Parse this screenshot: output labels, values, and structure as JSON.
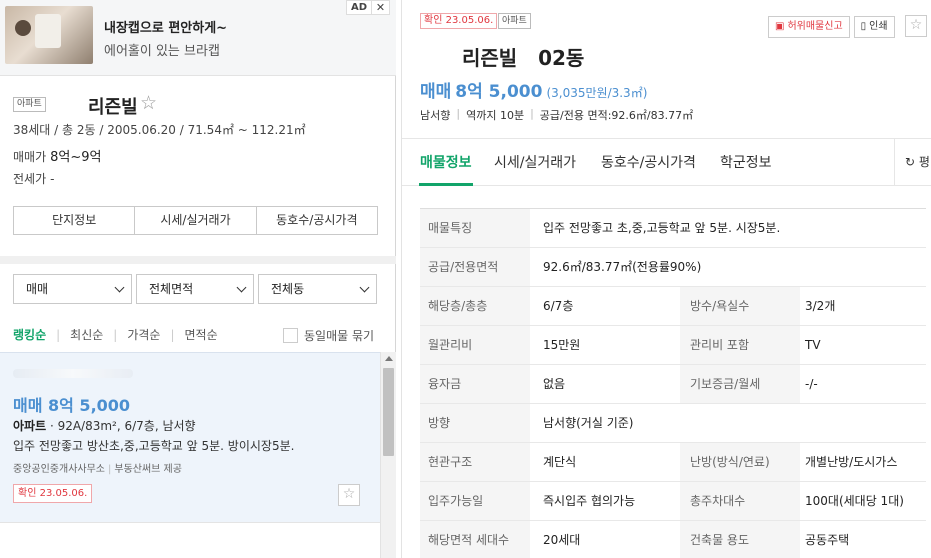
{
  "ad": {
    "title": "내장캡으로 편안하게~",
    "subtitle": "에어홀이 있는 브라캡",
    "badge": "AD",
    "close": "✕"
  },
  "complex": {
    "type_tag": "아파트",
    "name": "리즌빌",
    "star": "☆",
    "info": "38세대 / 총 2동 / 2005.06.20 / 71.54㎡ ~ 112.21㎡",
    "trade_label": "매매가",
    "trade_value": "8억~9억",
    "jeonse_label": "전세가",
    "jeonse_value": "-",
    "buttons": [
      "단지정보",
      "시세/실거래가",
      "동호수/공시가격"
    ]
  },
  "filters": {
    "trade_type": "매매",
    "area": "전체면적",
    "dong": "전체동",
    "sorts": [
      "랭킹순",
      "최신순",
      "가격순",
      "면적순"
    ],
    "group_label": "동일매물 묶기"
  },
  "listing": {
    "price": "매매 8억 5,000",
    "type": "아파트",
    "spec": " · 92A/83m², 6/7층, 남서향",
    "desc": "입주 전망좋고 방산초,중,고등학교 앞 5분. 방이시장5분.",
    "agent": "중앙공인중개사사무소",
    "provider": "부동산써브 제공",
    "confirm": "확인 23.05.06.",
    "fav": "☆"
  },
  "detail": {
    "confirm_tag": "확인 23.05.06.",
    "type_tag": "아파트",
    "report_btn": "허위매물신고",
    "print_btn": "인쇄",
    "fav": "☆",
    "title": "리즌빌   02동",
    "trade": "매매",
    "price": "8억 5,000",
    "unit_price": "(3,035만원/3.3㎡)",
    "summary": [
      "남서향",
      "역까지 10분",
      "공급/전용 면적:92.6㎡/83.77㎡"
    ],
    "tabs": [
      "매물정보",
      "시세/실거래가",
      "동호수/공시가격",
      "학군정보"
    ],
    "refresh": "평",
    "rows": [
      {
        "label": "매물특징",
        "value": "입주 전망좋고      초,중,고등학교 앞 5분.      시장5분."
      },
      {
        "label": "공급/전용면적",
        "value": "92.6㎡/83.77㎡(전용률90%)"
      },
      {
        "label": "해당층/총층",
        "value": "6/7층",
        "label2": "방수/욕실수",
        "value2": "3/2개"
      },
      {
        "label": "월관리비",
        "value": "15만원",
        "label2": "관리비 포함",
        "value2": "TV"
      },
      {
        "label": "융자금",
        "value": "없음",
        "label2": "기보증금/월세",
        "value2": "-/-"
      },
      {
        "label": "방향",
        "value": "남서향(거실 기준)"
      },
      {
        "label": "현관구조",
        "value": "계단식",
        "label2": "난방(방식/연료)",
        "value2": "개별난방/도시가스"
      },
      {
        "label": "입주가능일",
        "value": "즉시입주 협의가능",
        "label2": "총주차대수",
        "value2": "100대(세대당 1대)"
      },
      {
        "label": "해당면적 세대수",
        "value": "20세대",
        "label2": "건축물 용도",
        "value2": "공동주택"
      }
    ]
  }
}
